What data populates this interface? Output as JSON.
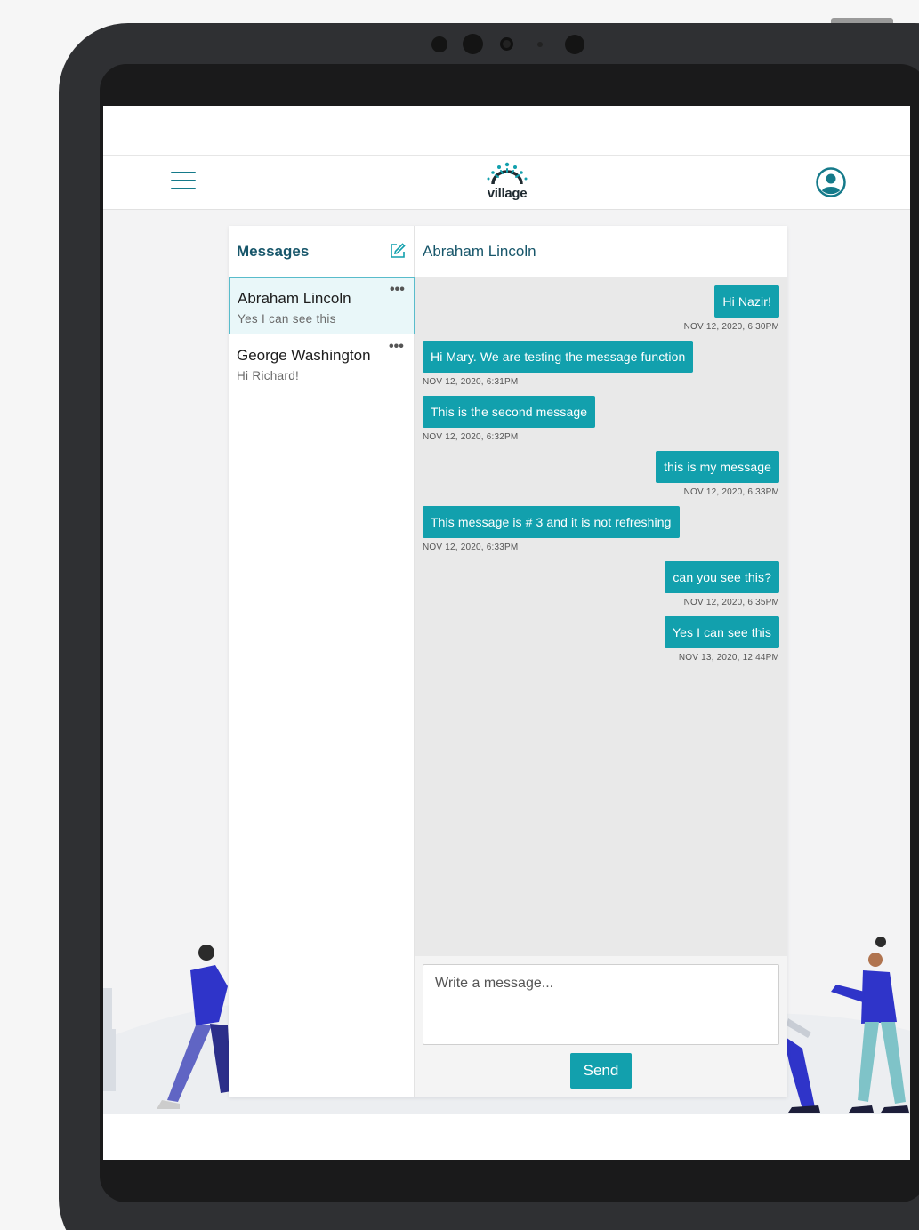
{
  "app": {
    "logo_text": "village"
  },
  "icons": {
    "menu": "hamburger-menu-icon",
    "profile": "user-circle-icon",
    "compose": "edit-square-icon",
    "more": "ellipsis-icon"
  },
  "colors": {
    "accent": "#12a0ad",
    "heading": "#17566a",
    "active_item": "#e9f7f9",
    "active_border": "#59bccb"
  },
  "sidebar": {
    "title": "Messages",
    "conversations": [
      {
        "name": "Abraham Lincoln",
        "preview": "Yes I can see this",
        "more": "•••",
        "active": true
      },
      {
        "name": "George Washington",
        "preview": "Hi Richard!",
        "more": "•••",
        "active": false
      }
    ]
  },
  "chat": {
    "title": "Abraham Lincoln",
    "messages": [
      {
        "direction": "out",
        "text": "Hi Nazir!",
        "time": "NOV 12, 2020, 6:30PM"
      },
      {
        "direction": "in",
        "text": "Hi Mary. We are testing the message function",
        "time": "NOV 12, 2020, 6:31PM"
      },
      {
        "direction": "in",
        "text": "This is the second message",
        "time": "NOV 12, 2020, 6:32PM"
      },
      {
        "direction": "out",
        "text": "this is my message",
        "time": "NOV 12, 2020, 6:33PM"
      },
      {
        "direction": "in",
        "text": "This message is # 3 and it is not refreshing",
        "time": "NOV 12, 2020, 6:33PM"
      },
      {
        "direction": "out",
        "text": "can you see this?",
        "time": "NOV 12, 2020, 6:35PM"
      },
      {
        "direction": "out",
        "text": "Yes I can see this",
        "time": "NOV 13, 2020, 12:44PM"
      }
    ]
  },
  "composer": {
    "placeholder": "Write a message...",
    "value": "",
    "send_label": "Send"
  }
}
